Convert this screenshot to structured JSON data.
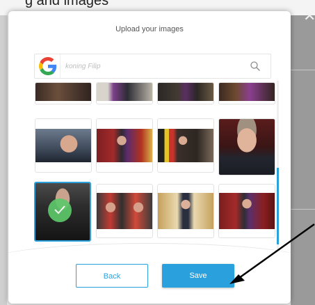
{
  "background": {
    "page_text": "g and images"
  },
  "modal": {
    "title": "Upload your images",
    "close_icon": "close-icon"
  },
  "search": {
    "placeholder": "koning Filip",
    "search_icon": "search-icon",
    "provider_icon": "google-g-icon"
  },
  "grid": {
    "rows": [
      [
        "top-partial",
        "top-partial",
        "top-partial",
        "top-partial"
      ],
      [
        "photo",
        "photo",
        "photo",
        "photo"
      ],
      [
        "photo-selected",
        "photo",
        "photo",
        "photo"
      ]
    ],
    "selected_index": 8
  },
  "buttons": {
    "back_label": "Back",
    "save_label": "Save"
  },
  "colors": {
    "accent": "#2aa1dd",
    "check": "#5dc86a",
    "arrow": "#000000"
  }
}
